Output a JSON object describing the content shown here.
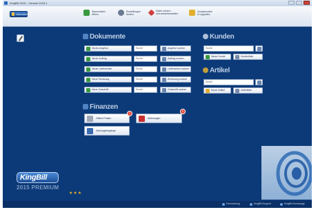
{
  "window": {
    "title": "KingBill 2015 – Version 2015.1"
  },
  "ribbon": {
    "start_label": "Übersicht",
    "items": [
      {
        "label_line1": "Stammdaten",
        "label_line2": "öffnen",
        "color": "#3a9a40"
      },
      {
        "label_line1": "Einstellungen",
        "label_line2": "ändern",
        "color": "#6a7a90"
      },
      {
        "label_line1": "Daten sichern",
        "label_line2": "und wiederherstellen",
        "color": "#d04040"
      },
      {
        "label_line1": "Zusatzmodule",
        "label_line2": "& Upgrades",
        "color": "#e0b030"
      }
    ]
  },
  "dokumente": {
    "title": "Dokumente",
    "rows": [
      {
        "new_label": "Neues Angebot",
        "search_placeholder": "Suche",
        "action_label": "Angebot suchen",
        "color": "#3a9a40"
      },
      {
        "new_label": "Neuer Auftrag",
        "search_placeholder": "Suche",
        "action_label": "Auftrag suchen",
        "color": "#3a9a40"
      },
      {
        "new_label": "Neuer Lieferschein",
        "search_placeholder": "Suche",
        "action_label": "Lieferschein suchen",
        "color": "#3a9a40"
      },
      {
        "new_label": "Neue Rechnung",
        "search_placeholder": "Suche",
        "action_label": "Rechnung suchen",
        "color": "#3a9a40"
      },
      {
        "new_label": "Neue Gutschrift",
        "search_placeholder": "Suche",
        "action_label": "Gutschrift suchen",
        "color": "#3a9a40"
      }
    ]
  },
  "finanzen": {
    "title": "Finanzen",
    "open_items_label": "Offene Posten",
    "open_items_count": "1",
    "reminders_label": "Mahnungen",
    "reminders_count": "1",
    "payments_label": "Zahlungseingänge"
  },
  "kunden": {
    "title": "Kunden",
    "search_placeholder": "Suche",
    "new_label": "Neuer Kunde",
    "list_label": "Kundenliste"
  },
  "artikel": {
    "title": "Artikel",
    "search_placeholder": "Suche",
    "new_label": "Neuer Artikel",
    "list_label": "Artikelliste"
  },
  "branding": {
    "name": "KingBill",
    "edition": "2015 PREMIUM",
    "stars": "★★★"
  },
  "status_links": [
    {
      "label": "Fernwartung"
    },
    {
      "label": "KingBill-Support"
    },
    {
      "label": "KingBill Homepage"
    }
  ]
}
